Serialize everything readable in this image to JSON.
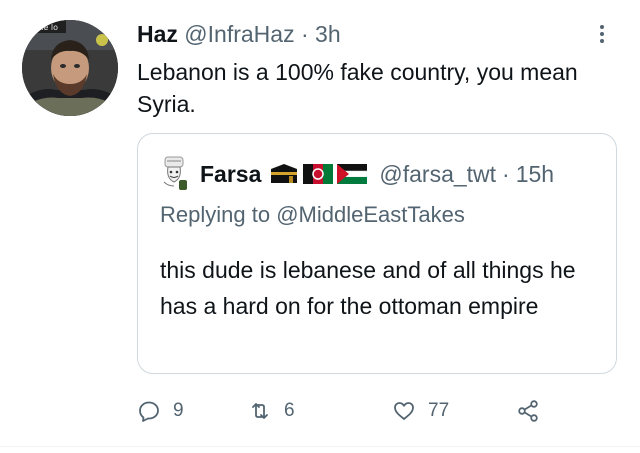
{
  "tweet": {
    "author_name": "Haz",
    "author_handle": "@InfraHaz",
    "separator": "·",
    "time": "3h",
    "text": "Lebanon is a 100% fake country, you mean Syria.",
    "avatar_badge_text": "k the lo"
  },
  "quoted": {
    "author_name": "Farsa",
    "author_handle": "@farsa_twt",
    "separator": "·",
    "time": "15h",
    "replying_prefix": "Replying to",
    "replying_to": "@MiddleEastTakes",
    "text": "this dude is lebanese and of all things he has a hard on for the ottoman empire",
    "flags": [
      "kaaba-icon",
      "afghanistan-flag-icon",
      "palestine-flag-icon"
    ]
  },
  "actions": {
    "reply_count": "9",
    "retweet_count": "6",
    "like_count": "77"
  },
  "colors": {
    "text": "#0f1419",
    "muted": "#536471",
    "border": "#cfd9de"
  }
}
